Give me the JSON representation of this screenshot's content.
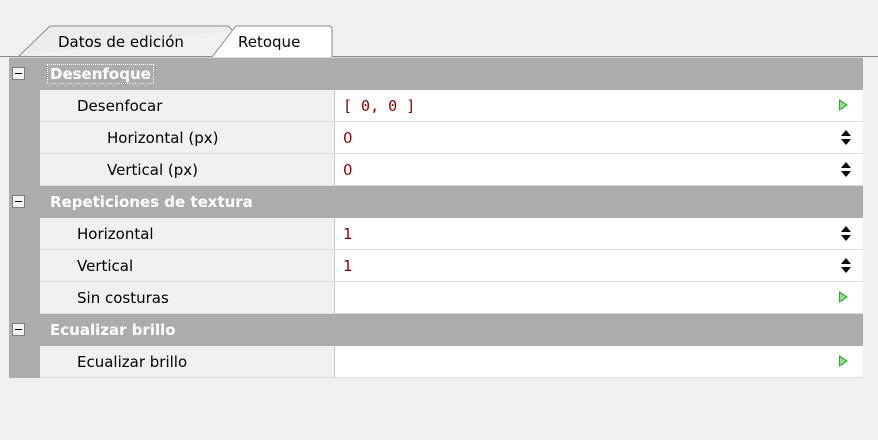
{
  "tabs": [
    {
      "label": "Datos de edición",
      "active": false
    },
    {
      "label": "Retoque",
      "active": true
    }
  ],
  "categories": [
    {
      "label": "Desenfoque",
      "rows": [
        {
          "label": "Desenfocar",
          "value": "[ 0, 0 ]",
          "editor": "play-icon"
        },
        {
          "label": "Horizontal (px)",
          "value": "0",
          "editor": "spinner-icon"
        },
        {
          "label": "Vertical (px)",
          "value": "0",
          "editor": "spinner-icon"
        }
      ]
    },
    {
      "label": "Repeticiones de textura",
      "rows": [
        {
          "label": "Horizontal",
          "value": "1",
          "editor": "spinner-icon"
        },
        {
          "label": "Vertical",
          "value": "1",
          "editor": "spinner-icon"
        },
        {
          "label": "Sin costuras",
          "value": "",
          "editor": "play-icon"
        }
      ]
    },
    {
      "label": "Ecualizar brillo",
      "rows": [
        {
          "label": "Ecualizar brillo",
          "value": "",
          "editor": "play-icon"
        }
      ]
    }
  ],
  "colors": {
    "category_bg": "#acacac",
    "value_text": "#800000",
    "play_icon": "#2fa83a"
  }
}
